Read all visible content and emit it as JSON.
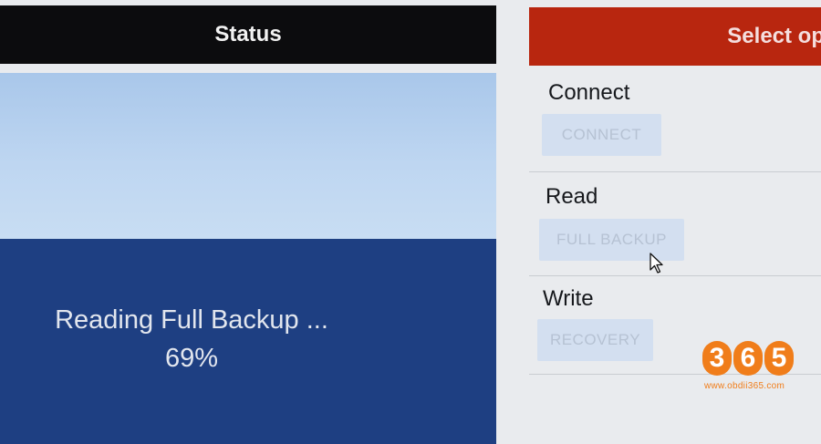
{
  "status": {
    "header": "Status",
    "message": "Reading Full Backup ...",
    "progress": "69%"
  },
  "options": {
    "header": "Select op",
    "sections": [
      {
        "label": "Connect",
        "button": "CONNECT"
      },
      {
        "label": "Read",
        "button": "FULL BACKUP"
      },
      {
        "label": "Write",
        "button": "RECOVERY"
      }
    ]
  },
  "watermark": {
    "digits": [
      "3",
      "6",
      "5"
    ],
    "url": "www.obdii365.com"
  },
  "icons": {
    "cursor": "mouse-pointer-icon"
  },
  "colors": {
    "status_header": "#0c0c0e",
    "options_header": "#b8260f",
    "status_panel": "#1e3f82",
    "button_bg": "#d3dff0",
    "logo": "#f07d1a"
  }
}
